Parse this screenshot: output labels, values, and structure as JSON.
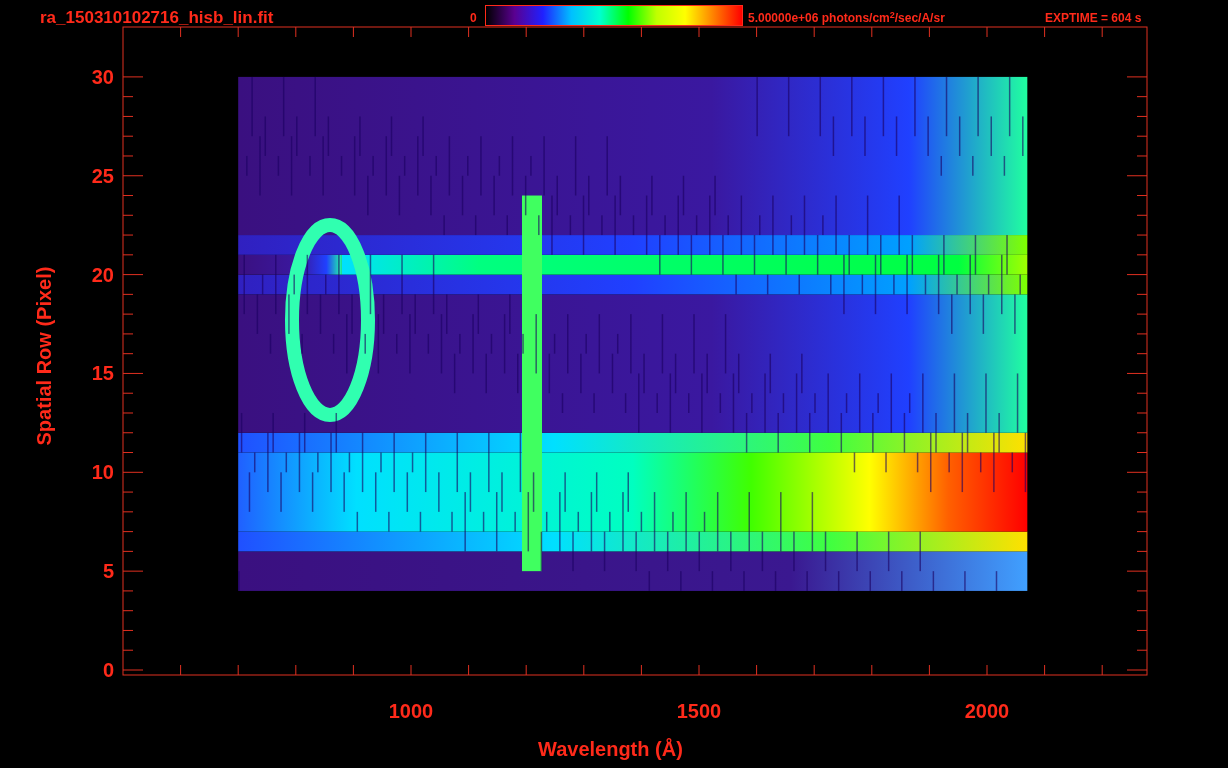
{
  "title": "ra_150310102716_hisb_lin.fit",
  "colorbar": {
    "min_label": "0",
    "max_label": "5.00000e+06 photons/cm$^{2}$/sec/A/sr"
  },
  "exposure": "EXPTIME = 604 s",
  "y_axis": {
    "label": "Spatial Row (Pixel)",
    "ticks": [
      "30",
      "25",
      "20",
      "15",
      "10",
      "5",
      "0"
    ]
  },
  "x_axis": {
    "label": "Wavelength (Å)",
    "ticks": [
      "1000",
      "1500",
      "2000"
    ]
  }
}
